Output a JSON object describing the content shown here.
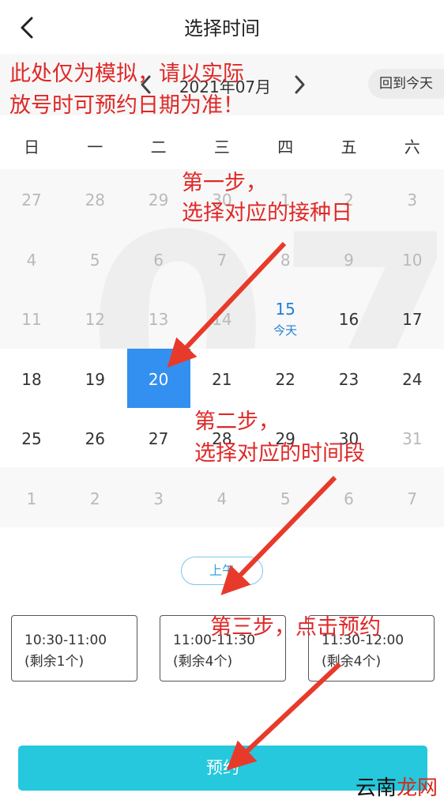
{
  "header": {
    "title": "选择时间",
    "back_icon": "chevron-left-icon"
  },
  "month_bar": {
    "label": "2021年07月",
    "today_button": "回到今天"
  },
  "weekdays": [
    "日",
    "一",
    "二",
    "三",
    "四",
    "五",
    "六"
  ],
  "calendar": {
    "watermark": "07",
    "rows": [
      [
        {
          "d": "27",
          "s": "muted"
        },
        {
          "d": "28",
          "s": "muted"
        },
        {
          "d": "29",
          "s": "muted"
        },
        {
          "d": "30",
          "s": "muted"
        },
        {
          "d": "1",
          "s": "muted"
        },
        {
          "d": "2",
          "s": "muted"
        },
        {
          "d": "3",
          "s": "muted"
        }
      ],
      [
        {
          "d": "4",
          "s": "muted"
        },
        {
          "d": "5",
          "s": "muted"
        },
        {
          "d": "6",
          "s": "muted"
        },
        {
          "d": "7",
          "s": "muted"
        },
        {
          "d": "8",
          "s": "muted"
        },
        {
          "d": "9",
          "s": "muted"
        },
        {
          "d": "10",
          "s": "muted"
        }
      ],
      [
        {
          "d": "11",
          "s": "muted"
        },
        {
          "d": "12",
          "s": "muted"
        },
        {
          "d": "13",
          "s": "muted"
        },
        {
          "d": "14",
          "s": "muted"
        },
        {
          "d": "15",
          "s": "today",
          "sub": "今天"
        },
        {
          "d": "16",
          "s": "normal"
        },
        {
          "d": "17",
          "s": "normal"
        }
      ],
      [
        {
          "d": "18",
          "s": "normal"
        },
        {
          "d": "19",
          "s": "normal"
        },
        {
          "d": "20",
          "s": "selected"
        },
        {
          "d": "21",
          "s": "normal"
        },
        {
          "d": "22",
          "s": "normal"
        },
        {
          "d": "23",
          "s": "normal"
        },
        {
          "d": "24",
          "s": "normal"
        }
      ],
      [
        {
          "d": "25",
          "s": "normal"
        },
        {
          "d": "26",
          "s": "normal"
        },
        {
          "d": "27",
          "s": "normal"
        },
        {
          "d": "28",
          "s": "normal"
        },
        {
          "d": "29",
          "s": "normal"
        },
        {
          "d": "30",
          "s": "normal"
        },
        {
          "d": "31",
          "s": "muted"
        }
      ],
      [
        {
          "d": "1",
          "s": "muted"
        },
        {
          "d": "2",
          "s": "muted"
        },
        {
          "d": "3",
          "s": "muted"
        },
        {
          "d": "4",
          "s": "muted"
        },
        {
          "d": "5",
          "s": "muted"
        },
        {
          "d": "6",
          "s": "muted"
        },
        {
          "d": "7",
          "s": "muted"
        }
      ]
    ]
  },
  "shift": {
    "label": "上午"
  },
  "slots": [
    {
      "time": "10:30-11:00",
      "remaining": "(剩余1个)"
    },
    {
      "time": "11:00-11:30",
      "remaining": "(剩余4个)"
    },
    {
      "time": "11:30-12:00",
      "remaining": "(剩余4个)"
    }
  ],
  "book_button": "预约",
  "annotations": {
    "notice_line1": "此处仅为模拟，请以实际",
    "notice_line2": "放号时可预约日期为准！",
    "step1_line1": "第一步，",
    "step1_line2": "选择对应的接种日",
    "step2_line1": "第二步，",
    "step2_line2": "选择对应的时间段",
    "step3": "第三步，点击预约"
  },
  "watermark_logo": {
    "part1": "云南",
    "part2": "龙网"
  },
  "colors": {
    "selected": "#3390f0",
    "today": "#1e7fd8",
    "book": "#25c8dc",
    "annotation": "#e02828"
  }
}
